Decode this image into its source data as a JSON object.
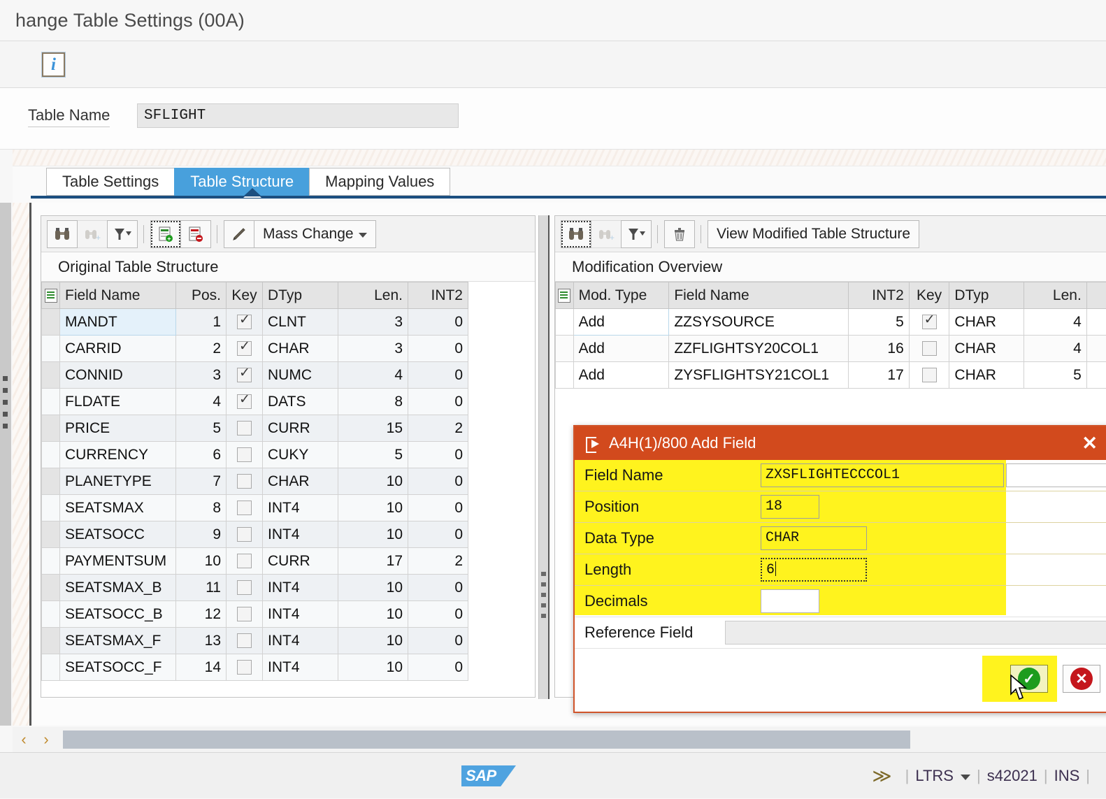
{
  "window": {
    "title": "hange Table Settings (00A)"
  },
  "app_toolbar": {
    "info_icon": "info-icon",
    "info_label": "i"
  },
  "header": {
    "table_name_label": "Table Name",
    "table_name_value": "SFLIGHT"
  },
  "tabs": [
    {
      "label": "Table Settings",
      "active": false
    },
    {
      "label": "Table Structure",
      "active": true
    },
    {
      "label": "Mapping Values",
      "active": false
    }
  ],
  "left_panel": {
    "subheader": "Original Table Structure",
    "toolbar": {
      "find_icon": "binoculars-icon",
      "find_next_icon": "binoculars-plus-icon",
      "filter_icon": "funnel-icon",
      "add_row_icon": "add-row-icon",
      "delete_row_icon": "delete-row-icon",
      "edit_icon": "pencil-icon",
      "mass_change_label": "Mass Change"
    },
    "columns": [
      "Field Name",
      "Pos.",
      "Key",
      "DTyp",
      "Len.",
      "INT2"
    ],
    "rows": [
      {
        "field": "MANDT",
        "pos": "1",
        "key": true,
        "dtyp": "CLNT",
        "len": "3",
        "int2": "0",
        "selected": true
      },
      {
        "field": "CARRID",
        "pos": "2",
        "key": true,
        "dtyp": "CHAR",
        "len": "3",
        "int2": "0"
      },
      {
        "field": "CONNID",
        "pos": "3",
        "key": true,
        "dtyp": "NUMC",
        "len": "4",
        "int2": "0"
      },
      {
        "field": "FLDATE",
        "pos": "4",
        "key": true,
        "dtyp": "DATS",
        "len": "8",
        "int2": "0"
      },
      {
        "field": "PRICE",
        "pos": "5",
        "key": false,
        "dtyp": "CURR",
        "len": "15",
        "int2": "2"
      },
      {
        "field": "CURRENCY",
        "pos": "6",
        "key": false,
        "dtyp": "CUKY",
        "len": "5",
        "int2": "0"
      },
      {
        "field": "PLANETYPE",
        "pos": "7",
        "key": false,
        "dtyp": "CHAR",
        "len": "10",
        "int2": "0"
      },
      {
        "field": "SEATSMAX",
        "pos": "8",
        "key": false,
        "dtyp": "INT4",
        "len": "10",
        "int2": "0"
      },
      {
        "field": "SEATSOCC",
        "pos": "9",
        "key": false,
        "dtyp": "INT4",
        "len": "10",
        "int2": "0"
      },
      {
        "field": "PAYMENTSUM",
        "pos": "10",
        "key": false,
        "dtyp": "CURR",
        "len": "17",
        "int2": "2"
      },
      {
        "field": "SEATSMAX_B",
        "pos": "11",
        "key": false,
        "dtyp": "INT4",
        "len": "10",
        "int2": "0"
      },
      {
        "field": "SEATSOCC_B",
        "pos": "12",
        "key": false,
        "dtyp": "INT4",
        "len": "10",
        "int2": "0"
      },
      {
        "field": "SEATSMAX_F",
        "pos": "13",
        "key": false,
        "dtyp": "INT4",
        "len": "10",
        "int2": "0"
      },
      {
        "field": "SEATSOCC_F",
        "pos": "14",
        "key": false,
        "dtyp": "INT4",
        "len": "10",
        "int2": "0"
      }
    ]
  },
  "right_panel": {
    "subheader": "Modification Overview",
    "toolbar": {
      "find_icon": "binoculars-icon",
      "find_next_icon": "binoculars-plus-icon",
      "filter_icon": "funnel-icon",
      "delete_icon": "trash-icon",
      "view_button_label": "View Modified Table Structure"
    },
    "columns": [
      "Mod. Type",
      "Field Name",
      "INT2",
      "Key",
      "DTyp",
      "Len."
    ],
    "rows": [
      {
        "mod_type": "Add",
        "field": "ZZSYSOURCE",
        "int2": "5",
        "key": true,
        "dtyp": "CHAR",
        "len": "4",
        "selected": true
      },
      {
        "mod_type": "Add",
        "field": "ZZFLIGHTSY20COL1",
        "int2": "16",
        "key": false,
        "dtyp": "CHAR",
        "len": "4"
      },
      {
        "mod_type": "Add",
        "field": "ZYSFLIGHTSY21COL1",
        "int2": "17",
        "key": false,
        "dtyp": "CHAR",
        "len": "5"
      }
    ]
  },
  "dialog": {
    "title": "A4H(1)/800 Add Field",
    "title_icon": "popup-window-icon",
    "close_icon": "close-icon",
    "fields": [
      {
        "label": "Field Name",
        "value": "ZXSFLIGHTECCCOL1"
      },
      {
        "label": "Position",
        "value": "18"
      },
      {
        "label": "Data Type",
        "value": "CHAR"
      },
      {
        "label": "Length",
        "value": "6",
        "focused": true
      },
      {
        "label": "Decimals",
        "value": ""
      },
      {
        "label": "Reference Field",
        "value": ""
      }
    ],
    "ok_icon": "green-check-icon",
    "cancel_icon": "red-cross-icon"
  },
  "bottom_scroll": {
    "left_arrow": "‹",
    "right_arrow": "›",
    "grip_icon": "scroll-grip-icon"
  },
  "status_bar": {
    "logo": "SAP",
    "expand_icon": "double-chevron-right-icon",
    "system": "LTRS",
    "server": "s42021",
    "mode": "INS",
    "sep": "|"
  },
  "colors": {
    "accent_blue": "#48a0dc",
    "tab_underline": "#1c4f80",
    "dialog_header": "#d24a1d",
    "highlight_yellow": "#fff31e",
    "ok_green": "#1e9c1e",
    "cancel_red": "#c4161c",
    "sap_logo_blue": "#4fa3e0"
  }
}
